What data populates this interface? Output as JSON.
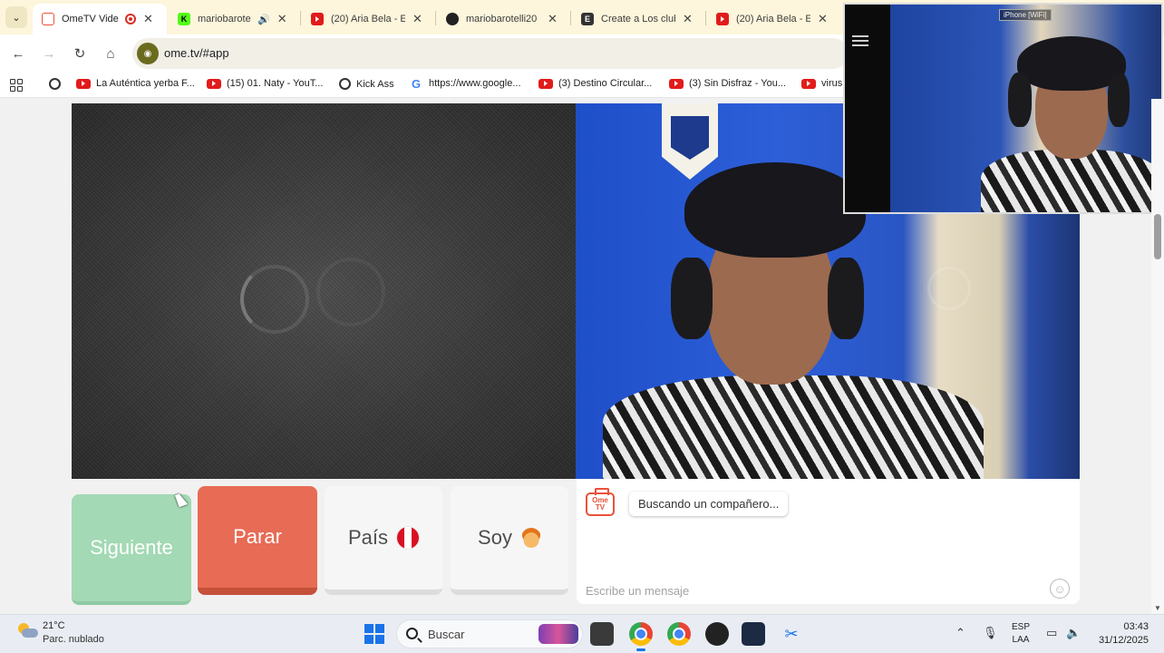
{
  "browser": {
    "tabs": [
      {
        "title": "OmeTV Vide",
        "favicon": "ometv-icon",
        "active": true,
        "recording": true
      },
      {
        "title": "mariobarote",
        "favicon": "kick-icon",
        "audio": true
      },
      {
        "title": "(20) Aria Bela - E",
        "favicon": "youtube-icon"
      },
      {
        "title": "mariobarotelli20",
        "favicon": "github-icon"
      },
      {
        "title": "Create a Los club",
        "favicon": "site-icon"
      },
      {
        "title": "(20) Aria Bela - E",
        "favicon": "youtube-icon"
      }
    ],
    "url": "ome.tv/#app",
    "bookmarks": [
      {
        "label": "La Auténtica yerba F...",
        "icon": "youtube-icon"
      },
      {
        "label": "(15) 01. Naty - YouT...",
        "icon": "youtube-icon"
      },
      {
        "label": "Kick Ass",
        "icon": "globe-icon"
      },
      {
        "label": "https://www.google...",
        "icon": "google-icon"
      },
      {
        "label": "(3) Destino Circular...",
        "icon": "youtube-icon"
      },
      {
        "label": "(3) Sin Disfraz - You...",
        "icon": "youtube-icon"
      },
      {
        "label": "virus",
        "icon": "youtube-icon"
      }
    ]
  },
  "pip": {
    "label": "iPhone [WiFi]"
  },
  "controls": {
    "next_label": "Siguiente",
    "stop_label": "Parar",
    "country_label": "País",
    "me_label": "Soy"
  },
  "chat": {
    "status_message": "Buscando un compañero...",
    "input_placeholder": "Escribe un mensaje",
    "logo_text": "Ome TV"
  },
  "taskbar": {
    "temperature": "21°C",
    "weather": "Parc. nublado",
    "search_label": "Buscar",
    "lang_primary": "ESP",
    "lang_secondary": "LAA",
    "time": "03:43",
    "date": "31/12/2025"
  },
  "colors": {
    "next_button": "#a3d9b4",
    "stop_button": "#e76b55",
    "brand_accent": "#e8523b"
  }
}
